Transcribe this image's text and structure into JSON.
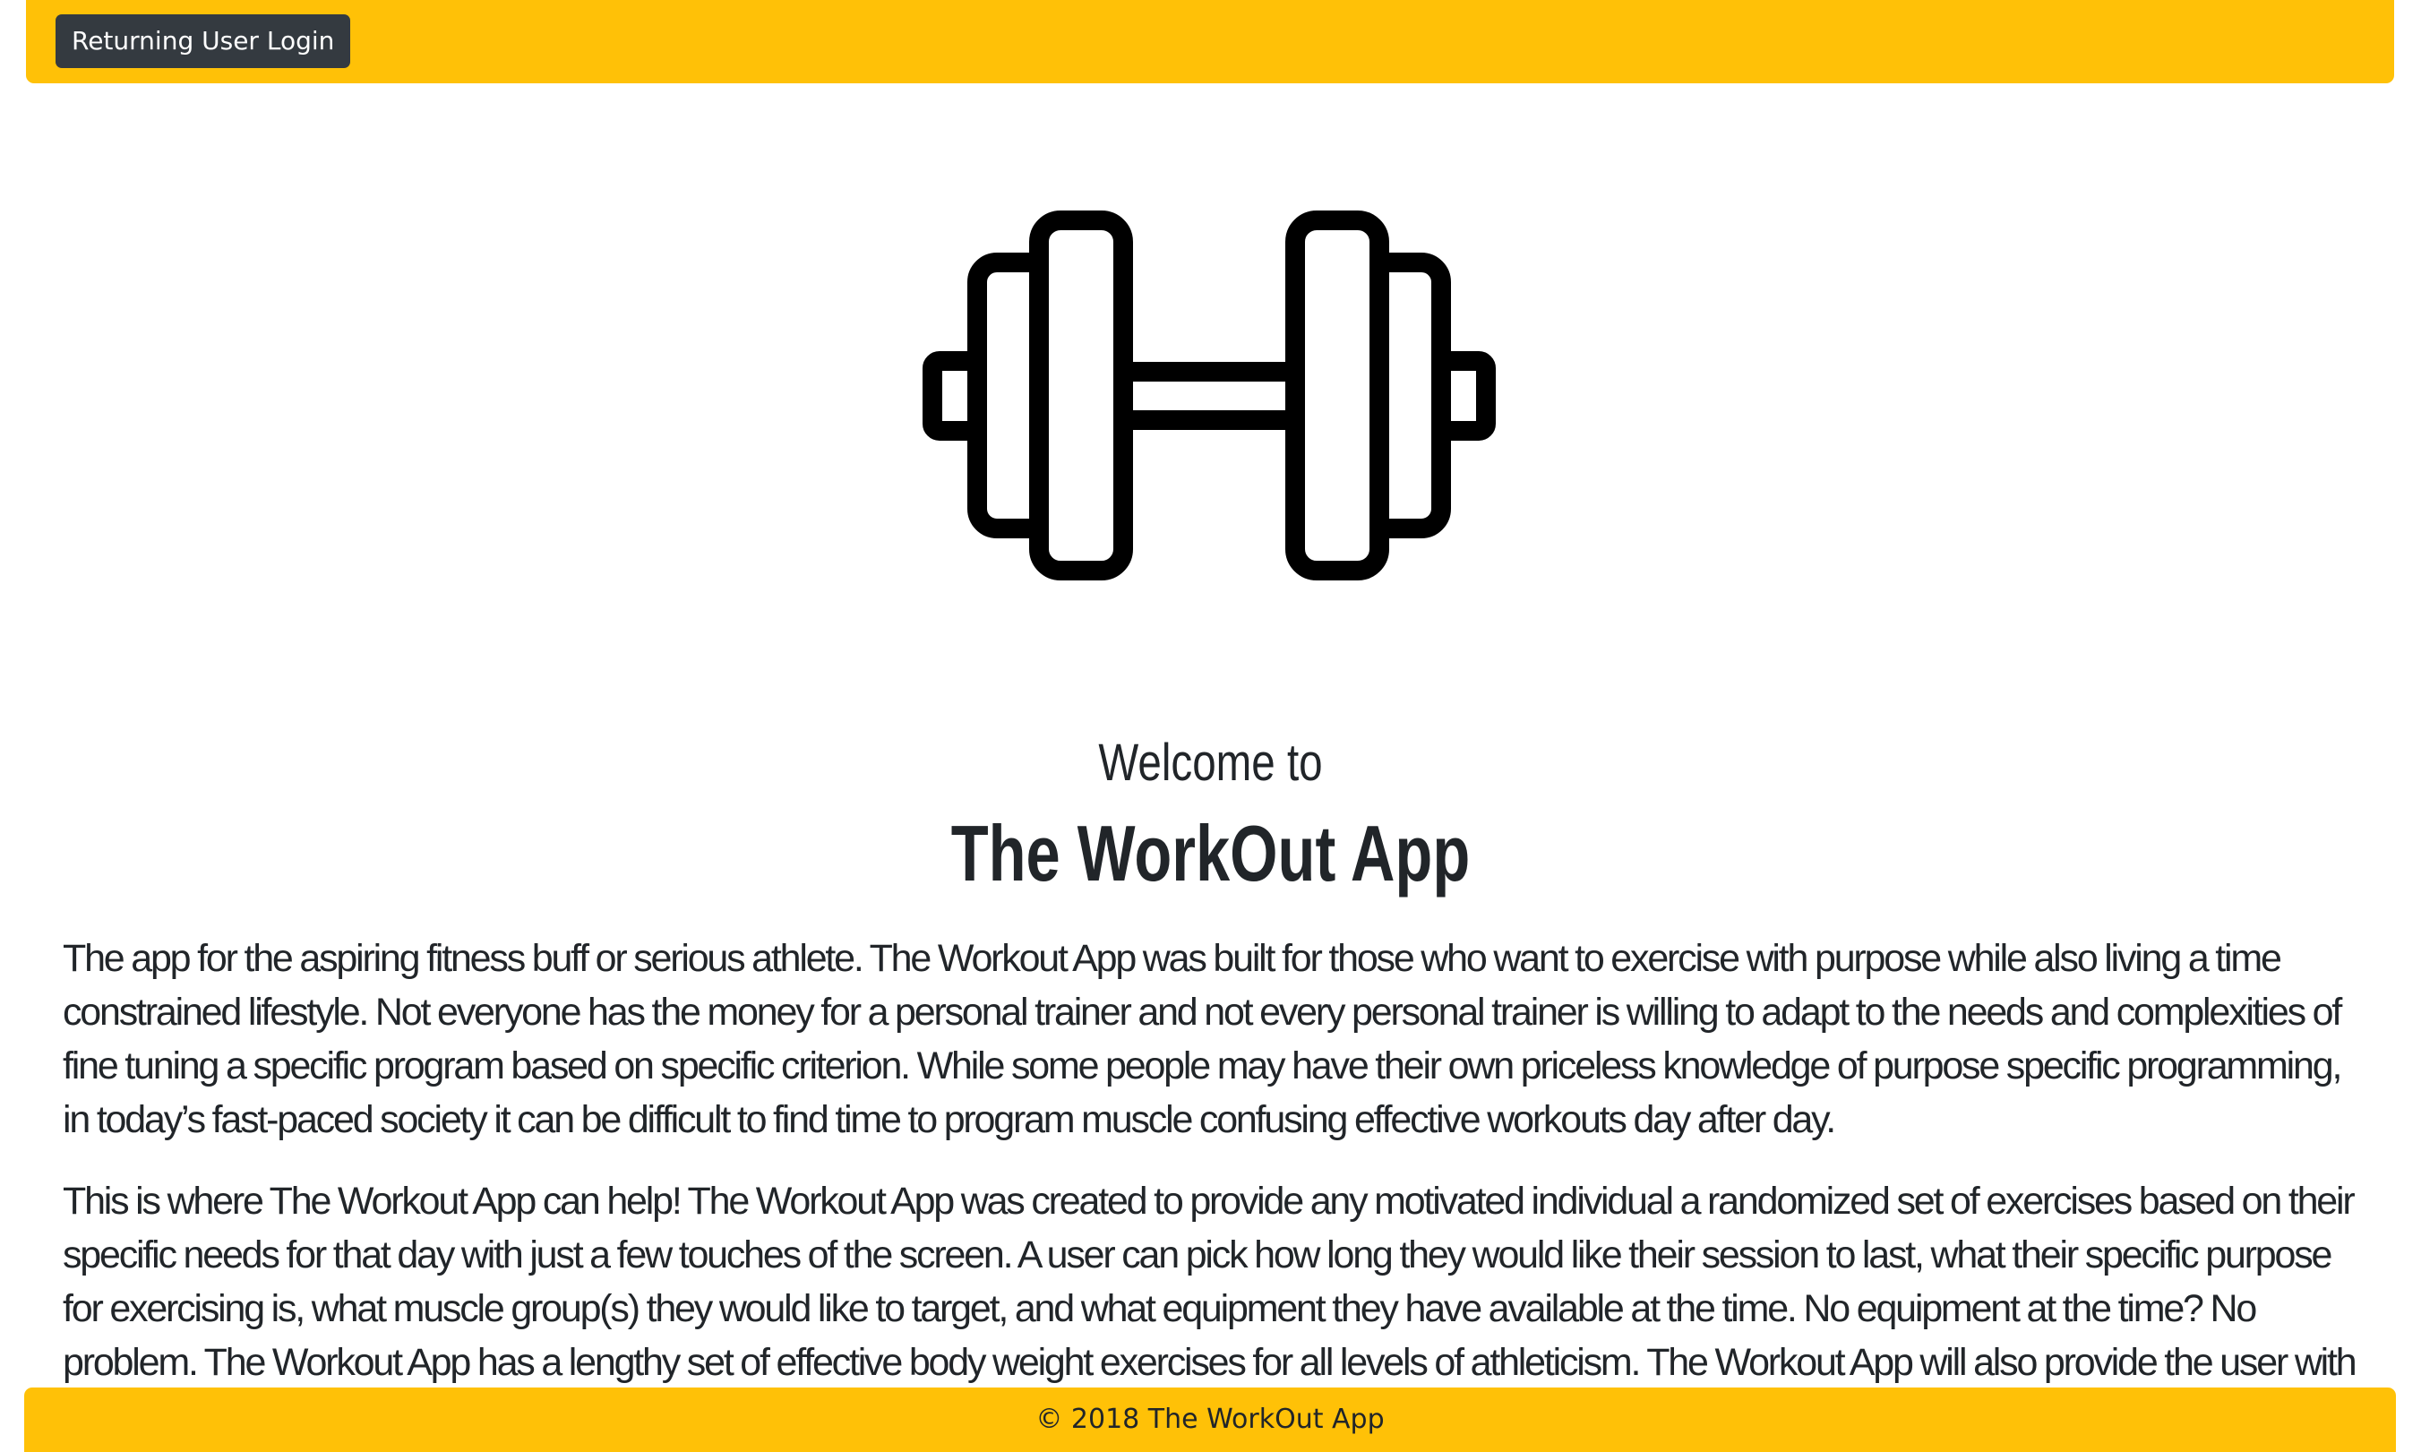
{
  "nav": {
    "login_label": "Returning User Login"
  },
  "hero": {
    "icon": "dumbbell-icon",
    "welcome": "Welcome to",
    "title": "The WorkOut App"
  },
  "content": {
    "paragraphs": [
      "The app for the aspiring fitness buff or serious athlete. The Workout App was built for those who want to exercise with purpose while also living a time constrained lifestyle. Not everyone has the money for a personal trainer and not every personal trainer is willing to adapt to the needs and complexities of fine tuning a specific program based on specific criterion. While some people may have their own priceless knowledge of purpose specific programming, in today’s fast-paced society it can be difficult to find time to program muscle confusing effective workouts day after day.",
      "This is where The Workout App can help! The Workout App was created to provide any motivated individual a randomized set of exercises based on their specific needs for that day with just a few touches of the screen. A user can pick how long they would like their session to last, what their specific purpose for exercising is, what muscle group(s) they would like to target, and what equipment they have available at the time. No equipment at the time? No problem. The Workout App has a lengthy set of effective body weight exercises for all levels of athleticism. The Workout App will also provide the user with recommended weight for each exercise based on some quick, and simple input. Say goodbye to the same old boring workout that is sure to"
    ]
  },
  "footer": {
    "text": "© 2018 The WorkOut App"
  },
  "colors": {
    "accent": "#ffc107",
    "button": "#343a40",
    "text": "#212529"
  }
}
